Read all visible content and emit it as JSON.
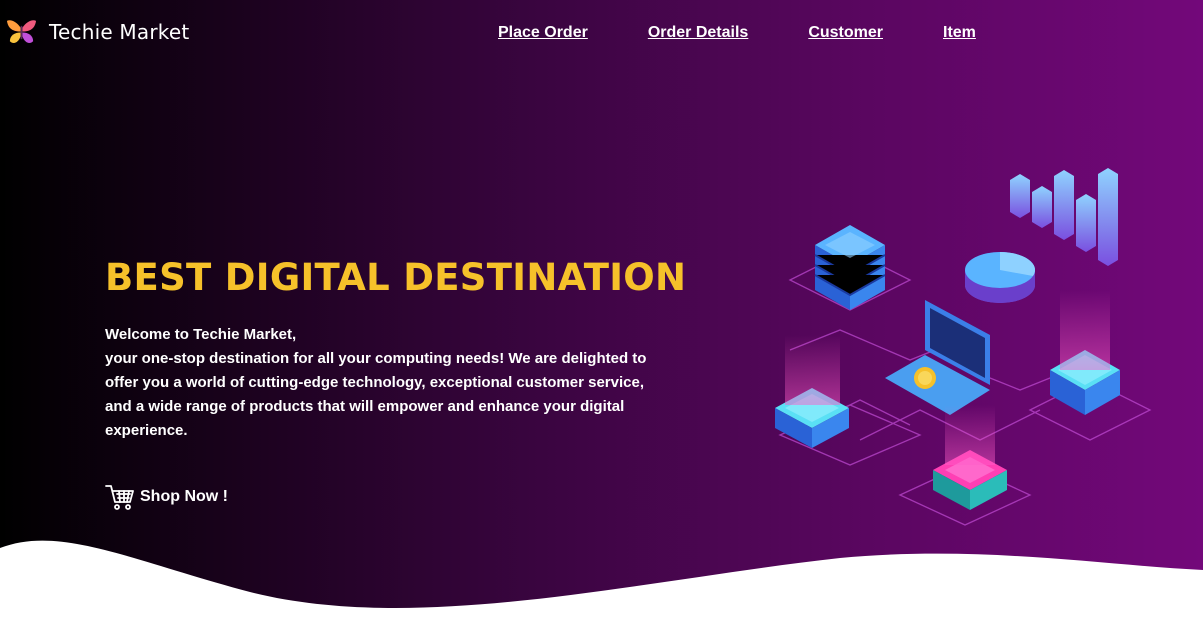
{
  "brand": {
    "name": "Techie Market",
    "logo_icon": "butterfly-logo-icon"
  },
  "nav": {
    "links": [
      {
        "label": "Place Order"
      },
      {
        "label": "Order Details"
      },
      {
        "label": "Customer"
      },
      {
        "label": "Item"
      }
    ]
  },
  "hero": {
    "title": "BEST DIGITAL DESTINATION",
    "greeting": "Welcome to Techie Market,",
    "description": "your one-stop destination for all your computing needs! We are delighted to offer you a world of cutting-edge technology, exceptional customer service, and a wide range of products that will empower and enhance your digital experience.",
    "cta": {
      "label": "Shop Now !",
      "icon": "shopping-cart-icon"
    }
  },
  "colors": {
    "title": "#f6c12a",
    "background_start": "#000000",
    "background_end": "#73087a",
    "accent_blue": "#3a8ee6",
    "accent_cyan": "#5fe3f5",
    "accent_pink": "#ff3fb4"
  },
  "illustration": {
    "icon": "isometric-data-center-illustration"
  }
}
